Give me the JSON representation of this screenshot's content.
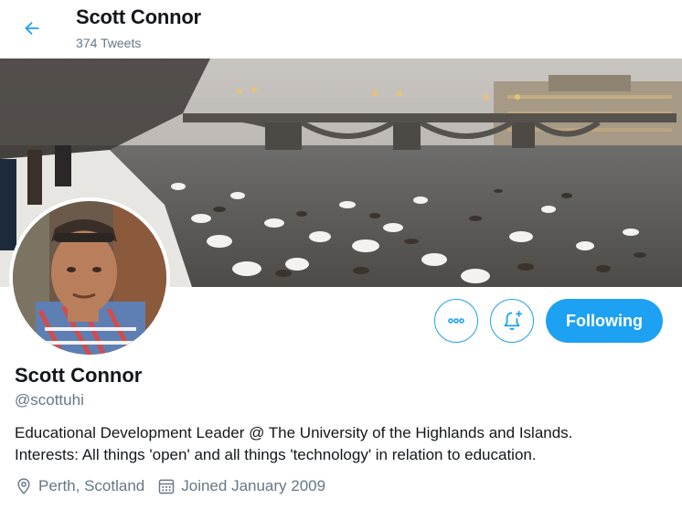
{
  "header": {
    "name": "Scott Connor",
    "tweet_count": "374 Tweets",
    "back_icon": "arrow-left-icon"
  },
  "profile": {
    "name": "Scott Connor",
    "handle": "@scottuhi",
    "bio_line1": "Educational Development Leader @ The University of the Highlands and Islands.",
    "bio_line2": "Interests: All things 'open' and all things 'technology' in relation to education.",
    "location": "Perth, Scotland",
    "joined": "Joined January 2009"
  },
  "actions": {
    "more_icon": "more-dots-icon",
    "notify_icon": "bell-plus-icon",
    "following_label": "Following"
  },
  "colors": {
    "accent": "#1da1f2",
    "secondary_text": "#657786",
    "primary_text": "#14171a"
  }
}
